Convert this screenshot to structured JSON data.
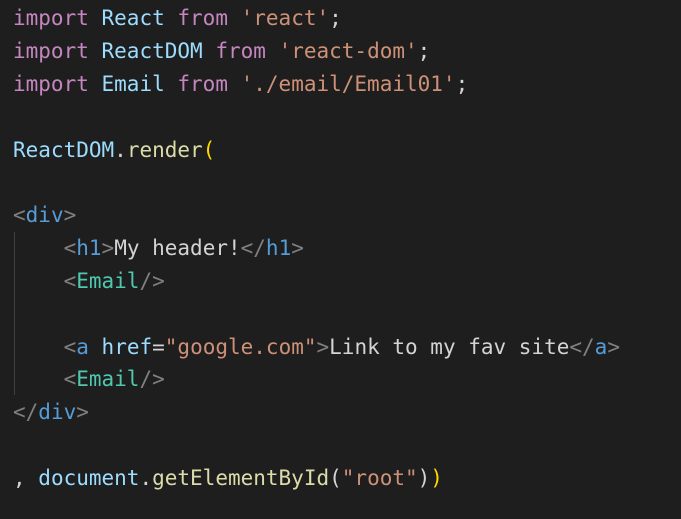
{
  "editor": {
    "lines": [
      {
        "tokens": [
          {
            "text": "import",
            "type": "kw"
          },
          {
            "text": " ",
            "type": "punct"
          },
          {
            "text": "React",
            "type": "var"
          },
          {
            "text": " ",
            "type": "punct"
          },
          {
            "text": "from",
            "type": "kw"
          },
          {
            "text": " ",
            "type": "punct"
          },
          {
            "text": "'react'",
            "type": "str"
          },
          {
            "text": ";",
            "type": "punct"
          }
        ]
      },
      {
        "tokens": [
          {
            "text": "import",
            "type": "kw"
          },
          {
            "text": " ",
            "type": "punct"
          },
          {
            "text": "ReactDOM",
            "type": "var"
          },
          {
            "text": " ",
            "type": "punct"
          },
          {
            "text": "from",
            "type": "kw"
          },
          {
            "text": " ",
            "type": "punct"
          },
          {
            "text": "'react-dom'",
            "type": "str"
          },
          {
            "text": ";",
            "type": "punct"
          }
        ]
      },
      {
        "tokens": [
          {
            "text": "import",
            "type": "kw"
          },
          {
            "text": " ",
            "type": "punct"
          },
          {
            "text": "Email",
            "type": "var"
          },
          {
            "text": " ",
            "type": "punct"
          },
          {
            "text": "from",
            "type": "kw"
          },
          {
            "text": " ",
            "type": "punct"
          },
          {
            "text": "'./email/Email01'",
            "type": "str"
          },
          {
            "text": ";",
            "type": "punct"
          }
        ]
      },
      {
        "tokens": []
      },
      {
        "tokens": [
          {
            "text": "ReactDOM",
            "type": "var"
          },
          {
            "text": ".",
            "type": "punct"
          },
          {
            "text": "render",
            "type": "fn"
          },
          {
            "text": "(",
            "type": "paren"
          }
        ]
      },
      {
        "tokens": []
      },
      {
        "tokens": [
          {
            "text": "<",
            "type": "tagp"
          },
          {
            "text": "div",
            "type": "tag"
          },
          {
            "text": ">",
            "type": "tagp"
          }
        ]
      },
      {
        "tokens": [
          {
            "text": "    ",
            "type": "punct"
          },
          {
            "text": "<",
            "type": "tagp"
          },
          {
            "text": "h1",
            "type": "tag"
          },
          {
            "text": ">",
            "type": "tagp"
          },
          {
            "text": "My header!",
            "type": "txt"
          },
          {
            "text": "</",
            "type": "tagp"
          },
          {
            "text": "h1",
            "type": "tag"
          },
          {
            "text": ">",
            "type": "tagp"
          }
        ]
      },
      {
        "tokens": [
          {
            "text": "    ",
            "type": "punct"
          },
          {
            "text": "<",
            "type": "tagp"
          },
          {
            "text": "Email",
            "type": "cls"
          },
          {
            "text": "/>",
            "type": "tagp"
          }
        ]
      },
      {
        "tokens": []
      },
      {
        "tokens": [
          {
            "text": "    ",
            "type": "punct"
          },
          {
            "text": "<",
            "type": "tagp"
          },
          {
            "text": "a",
            "type": "tag"
          },
          {
            "text": " ",
            "type": "punct"
          },
          {
            "text": "href",
            "type": "attr"
          },
          {
            "text": "=",
            "type": "punct"
          },
          {
            "text": "\"google.com\"",
            "type": "str"
          },
          {
            "text": ">",
            "type": "tagp"
          },
          {
            "text": "Link to my fav site",
            "type": "txt"
          },
          {
            "text": "</",
            "type": "tagp"
          },
          {
            "text": "a",
            "type": "tag"
          },
          {
            "text": ">",
            "type": "tagp"
          }
        ]
      },
      {
        "tokens": [
          {
            "text": "    ",
            "type": "punct"
          },
          {
            "text": "<",
            "type": "tagp"
          },
          {
            "text": "Email",
            "type": "cls"
          },
          {
            "text": "/>",
            "type": "tagp"
          }
        ]
      },
      {
        "tokens": [
          {
            "text": "</",
            "type": "tagp"
          },
          {
            "text": "div",
            "type": "tag"
          },
          {
            "text": ">",
            "type": "tagp"
          }
        ]
      },
      {
        "tokens": []
      },
      {
        "tokens": [
          {
            "text": ", ",
            "type": "punct"
          },
          {
            "text": "document",
            "type": "var"
          },
          {
            "text": ".",
            "type": "punct"
          },
          {
            "text": "getElementById",
            "type": "fn"
          },
          {
            "text": "(",
            "type": "punct"
          },
          {
            "text": "\"root\"",
            "type": "str"
          },
          {
            "text": ")",
            "type": "punct"
          },
          {
            "text": ")",
            "type": "paren"
          }
        ]
      }
    ]
  }
}
